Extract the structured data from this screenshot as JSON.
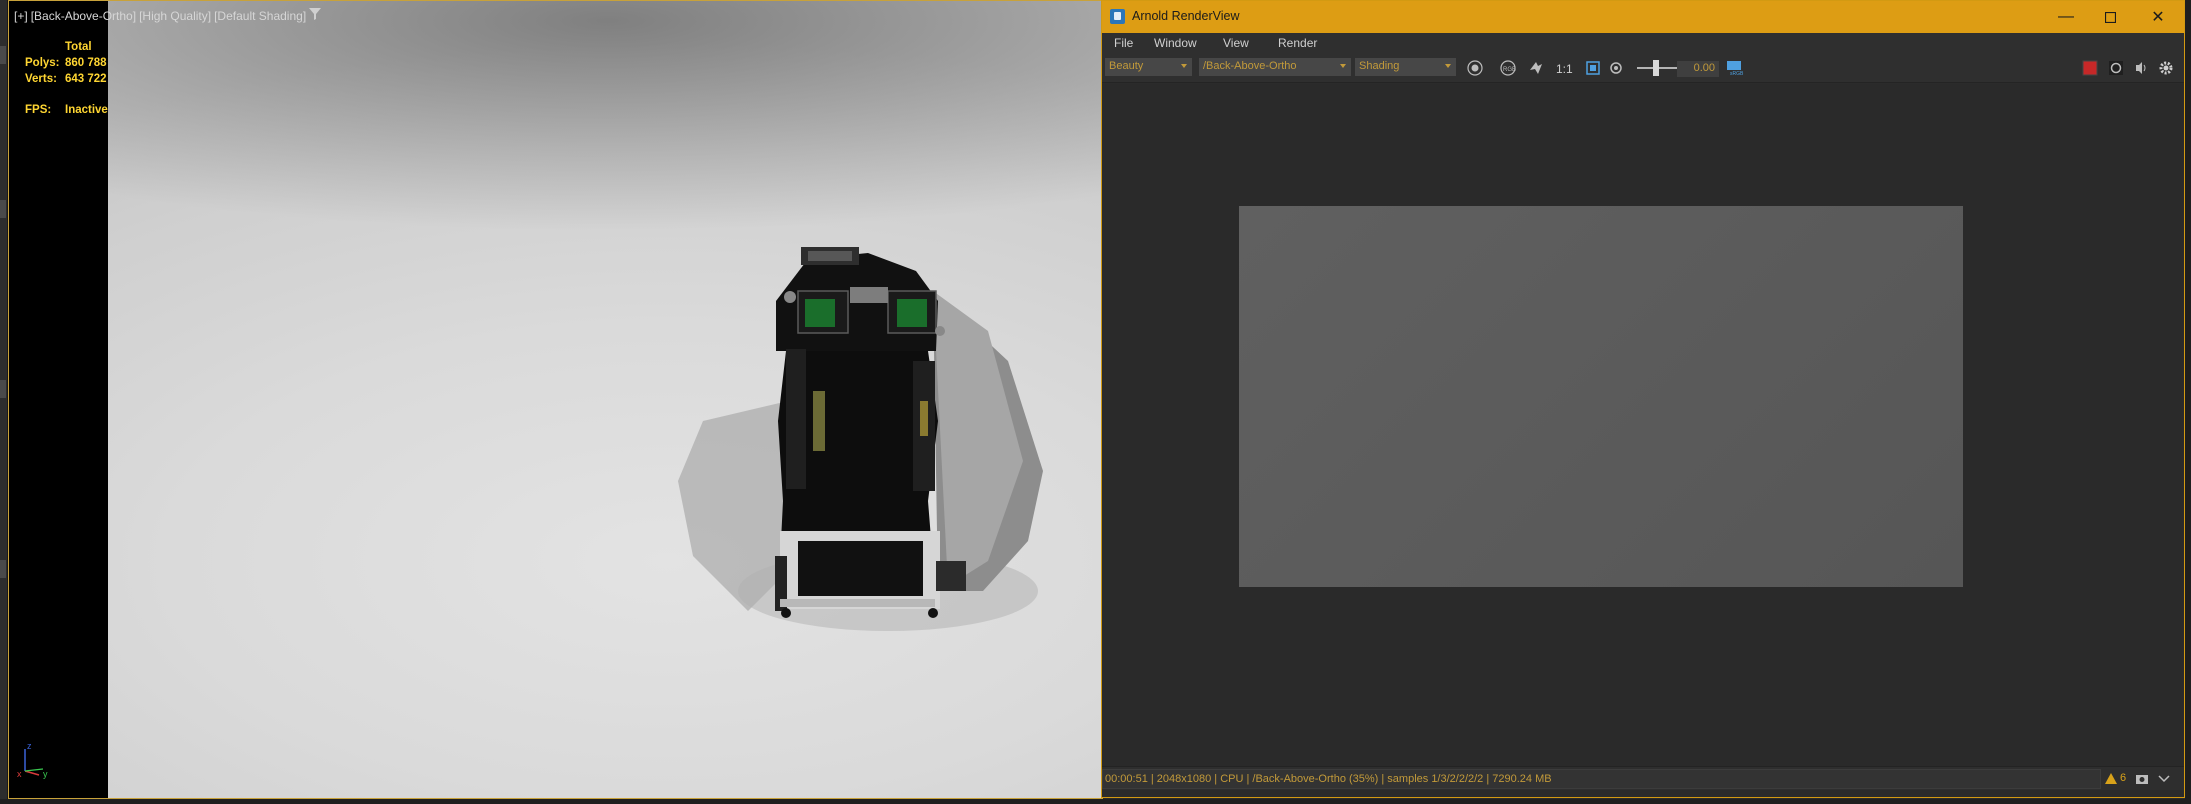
{
  "viewport": {
    "labels": [
      "[+]",
      "[Back-Above-Ortho]",
      "[High Quality]",
      "[Default Shading]"
    ],
    "stats": {
      "total_label": "Total",
      "polys_label": "Polys:",
      "polys_value": "860 788",
      "verts_label": "Verts:",
      "verts_value": "643 722",
      "fps_label": "FPS:",
      "fps_value": "Inactive"
    },
    "filter_icon": "funnel-icon",
    "axis": {
      "z": "z",
      "x": "x",
      "y": "y"
    }
  },
  "arnold": {
    "title": "Arnold RenderView",
    "window_controls": [
      "minimize-icon",
      "maximize-icon",
      "close-icon"
    ],
    "menu": [
      "File",
      "Window",
      "View",
      "Render"
    ],
    "toolbar": {
      "aov": "Beauty",
      "camera": "/Back-Above-Ortho",
      "mode": "Shading",
      "ratio_label": "1:1",
      "exposure": "0.00"
    },
    "status": "00:00:51 | 2048x1080 | CPU | /Back-Above-Ortho (35%) | samples 1/3/2/2/2/2 | 7290.24 MB",
    "warnings": "6"
  },
  "colors": {
    "titlebar": "#dd9d14",
    "accent_text": "#c29a3a",
    "stats_yellow": "#ffd632"
  }
}
